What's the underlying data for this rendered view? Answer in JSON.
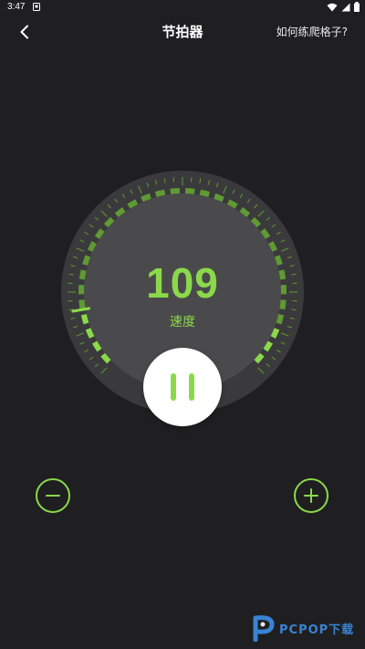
{
  "status_bar": {
    "time": "3:47"
  },
  "header": {
    "title": "节拍器",
    "help_link": "如何练爬格子?"
  },
  "metronome": {
    "bpm": "109",
    "label": "速度",
    "level_fraction": 0.5
  },
  "colors": {
    "accent": "#8bd94a",
    "accent_dim": "#5f9a33",
    "background": "#1f1f21",
    "dial_outer": "#3a3a3c",
    "dial_inner": "#4a4a4c"
  },
  "icons": {
    "back": "chevron-left-icon",
    "pause": "pause-icon",
    "decrease": "minus-icon",
    "increase": "plus-icon"
  },
  "watermark": {
    "text": "PCPOP下载"
  }
}
